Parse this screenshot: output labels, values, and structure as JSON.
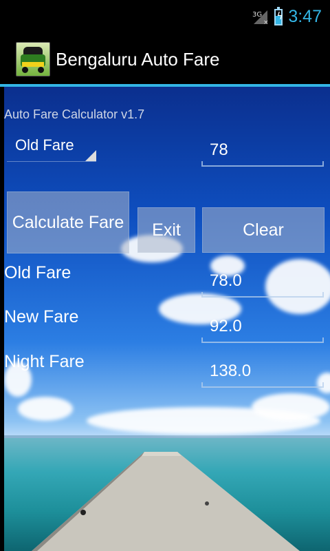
{
  "status_bar": {
    "network": "3G",
    "time": "3:47",
    "battery_level": 0.6
  },
  "action_bar": {
    "title": "Bengaluru Auto Fare",
    "icon": "auto-rickshaw-icon"
  },
  "form": {
    "version_text": "Auto Fare Calculator v1.7",
    "fare_type_selected": "Old Fare",
    "fare_input_value": "78",
    "buttons": {
      "calculate": "Calculate Fare",
      "exit": "Exit",
      "clear": "Clear"
    }
  },
  "results": {
    "old_fare_label": "Old Fare",
    "old_fare_value": "78.0",
    "new_fare_label": "New Fare",
    "new_fare_value": "92.0",
    "night_fare_label": "Night Fare",
    "night_fare_value": "138.0"
  },
  "colors": {
    "accent": "#33b5e5",
    "sky": "#0e4fc0",
    "sea": "#2aa4b3"
  }
}
